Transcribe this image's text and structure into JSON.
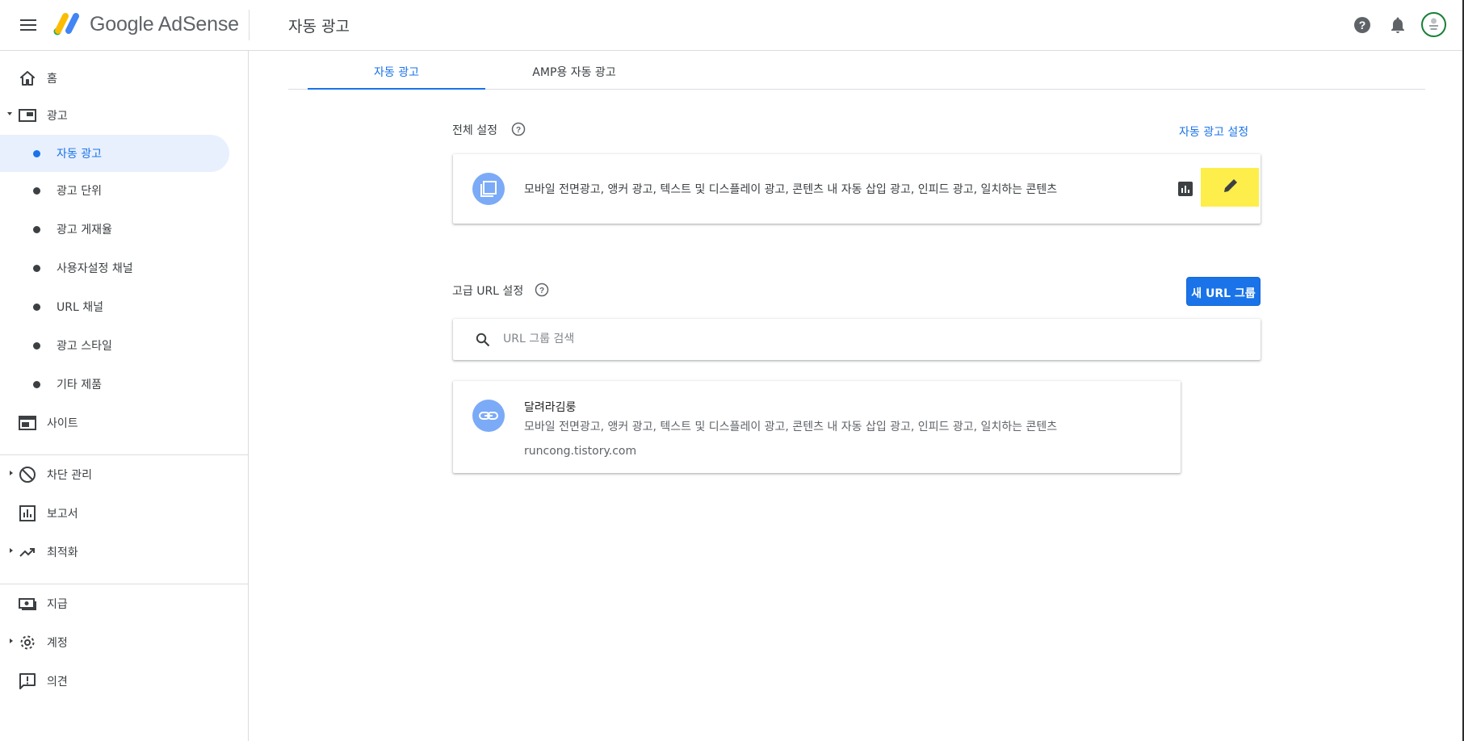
{
  "header": {
    "logo_text": "Google AdSense",
    "page_title": "자동 광고",
    "icons": [
      "menu-icon",
      "help-icon",
      "notifications-icon",
      "avatar"
    ]
  },
  "sidebar": {
    "home": "홈",
    "ads": "광고",
    "ads_sub": [
      "자동 광고",
      "광고 단위",
      "광고 게재율",
      "사용자설정 채널",
      "URL 채널",
      "광고 스타일",
      "기타 제품"
    ],
    "sites": "사이트",
    "blocking": "차단 관리",
    "reports": "보고서",
    "optimization": "최적화",
    "payments": "지급",
    "account": "계정",
    "feedback": "의견"
  },
  "tabs": [
    "자동 광고",
    "AMP용 자동 광고"
  ],
  "global_settings": {
    "title": "전체 설정",
    "link": "자동 광고 설정",
    "formats": "모바일 전면광고, 앵커 광고, 텍스트 및 디스플레이 광고, 콘텐츠 내 자동 삽입 광고, 인피드 광고, 일치하는 콘텐츠"
  },
  "advanced_url": {
    "title": "고급 URL 설정",
    "new_group_button": "새 URL 그룹",
    "search_placeholder": "URL 그룹 검색",
    "groups": [
      {
        "name": "달려라김룽",
        "formats": "모바일 전면광고, 앵커 광고, 텍스트 및 디스플레이 광고, 콘텐츠 내 자동 삽입 광고, 인피드 광고, 일치하는 콘텐츠",
        "url": "runcong.tistory.com"
      }
    ]
  },
  "colors": {
    "accent": "#1a73e8",
    "active_bg": "#e8f0fe",
    "highlight": "#fdee4b",
    "badge": "#7baaf7"
  }
}
